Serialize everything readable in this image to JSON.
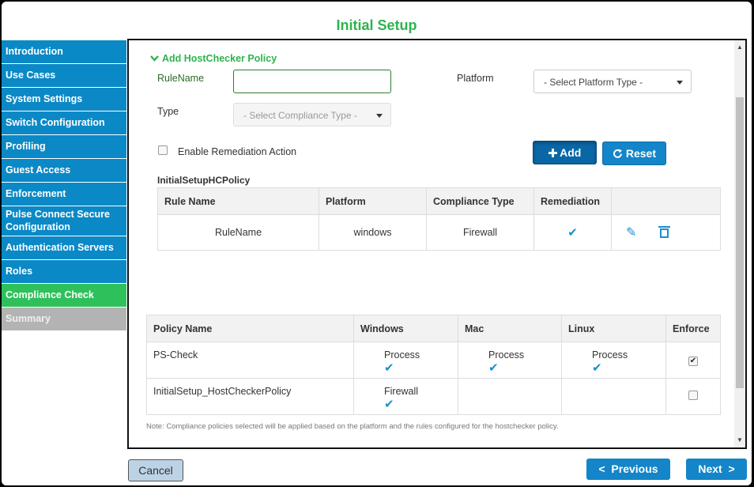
{
  "window": {
    "title": "Initial Setup"
  },
  "sidebar": {
    "items": [
      {
        "label": "Introduction"
      },
      {
        "label": "Use Cases"
      },
      {
        "label": "System Settings"
      },
      {
        "label": "Switch Configuration"
      },
      {
        "label": "Profiling"
      },
      {
        "label": "Guest Access"
      },
      {
        "label": "Enforcement"
      },
      {
        "label": "Pulse Connect Secure Configuration"
      },
      {
        "label": "Authentication Servers"
      },
      {
        "label": "Roles"
      },
      {
        "label": "Compliance Check"
      },
      {
        "label": "Summary"
      }
    ]
  },
  "form": {
    "section_title": "Add HostChecker Policy",
    "rulename_label": "RuleName",
    "rulename_value": "",
    "platform_label": "Platform",
    "platform_select": "- Select Platform Type -",
    "type_label": "Type",
    "type_select": "- Select Compliance Type -",
    "remediation_label": "Enable Remediation Action",
    "remediation_checked": false,
    "add_label": "Add",
    "reset_label": "Reset"
  },
  "rules_table": {
    "title": "InitialSetupHCPolicy",
    "headers": [
      "Rule Name",
      "Platform",
      "Compliance Type",
      "Remediation",
      ""
    ],
    "rows": [
      {
        "rule_name": "RuleName",
        "platform": "windows",
        "compliance_type": "Firewall",
        "remediation": true
      }
    ]
  },
  "policy_table": {
    "headers": [
      "Policy Name",
      "Windows",
      "Mac",
      "Linux",
      "Enforce"
    ],
    "rows": [
      {
        "name": "PS-Check",
        "windows": "Process",
        "mac": "Process",
        "linux": "Process",
        "enforce": true
      },
      {
        "name": "InitialSetup_HostCheckerPolicy",
        "windows": "Firewall",
        "mac": "",
        "linux": "",
        "enforce": false
      }
    ]
  },
  "note": "Note: Compliance policies selected will be applied based on the platform and the rules configured for the hostchecker policy.",
  "footer": {
    "cancel_label": "Cancel",
    "previous_label": "Previous",
    "next_label": "Next"
  },
  "colors": {
    "nav_blue": "#0b89c6",
    "active_green": "#2ec05a",
    "title_green": "#2db44d",
    "disabled_gray": "#b3b3b3"
  }
}
